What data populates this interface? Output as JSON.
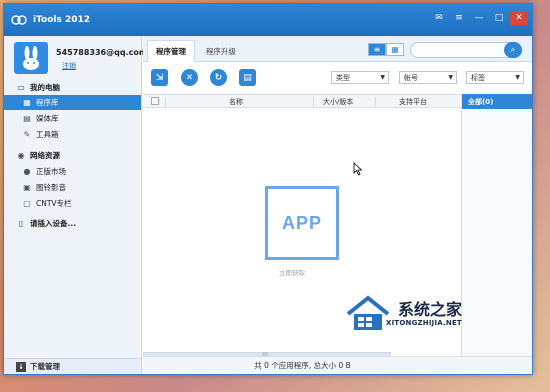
{
  "window": {
    "title": "iTools 2012",
    "controls": [
      "feedback-icon",
      "settings-icon",
      "minimize-icon",
      "maximize-icon",
      "close-icon"
    ]
  },
  "user": {
    "email": "545788336@qq.com",
    "logout_label": "注销"
  },
  "sidebar": {
    "sections": [
      {
        "label": "我的电脑",
        "icon": "computer-icon"
      },
      {
        "label": "网络资源",
        "icon": "globe-icon"
      },
      {
        "label": "请插入设备...",
        "icon": "phone-icon"
      }
    ],
    "items": [
      {
        "label": "程序库",
        "icon": "app-grid-icon",
        "active": true
      },
      {
        "label": "媒体库",
        "icon": "film-icon"
      },
      {
        "label": "工具箱",
        "icon": "wrench-icon"
      },
      {
        "label": "正版市场",
        "icon": "apple-icon"
      },
      {
        "label": "图铃影音",
        "icon": "image-icon"
      },
      {
        "label": "CNTV专栏",
        "icon": "tv-icon"
      }
    ],
    "downloads_label": "下载管理"
  },
  "tabs": [
    {
      "label": "程序管理",
      "active": true
    },
    {
      "label": "程序升级",
      "active": false
    }
  ],
  "search": {
    "placeholder": ""
  },
  "toolbar": {
    "buttons": [
      "import-icon",
      "delete-icon",
      "refresh-icon",
      "document-icon"
    ],
    "dropdowns": [
      {
        "label": "类型"
      },
      {
        "label": "帐号"
      },
      {
        "label": "标签"
      }
    ]
  },
  "list": {
    "columns": [
      "名称",
      "大小/版本",
      "支持平台"
    ]
  },
  "filter": {
    "all_label": "全部(0)"
  },
  "empty_state": {
    "icon_text": "APP",
    "caption": "立即获取"
  },
  "status": {
    "text": "共 0 个应用程序, 总大小 0 B"
  },
  "watermark": {
    "title": "系统之家",
    "subtitle": "XITONGZHIJIA.NET"
  },
  "colors": {
    "accent": "#2f86d6",
    "titlebar": "#1c6fc0",
    "close": "#d9463a"
  }
}
